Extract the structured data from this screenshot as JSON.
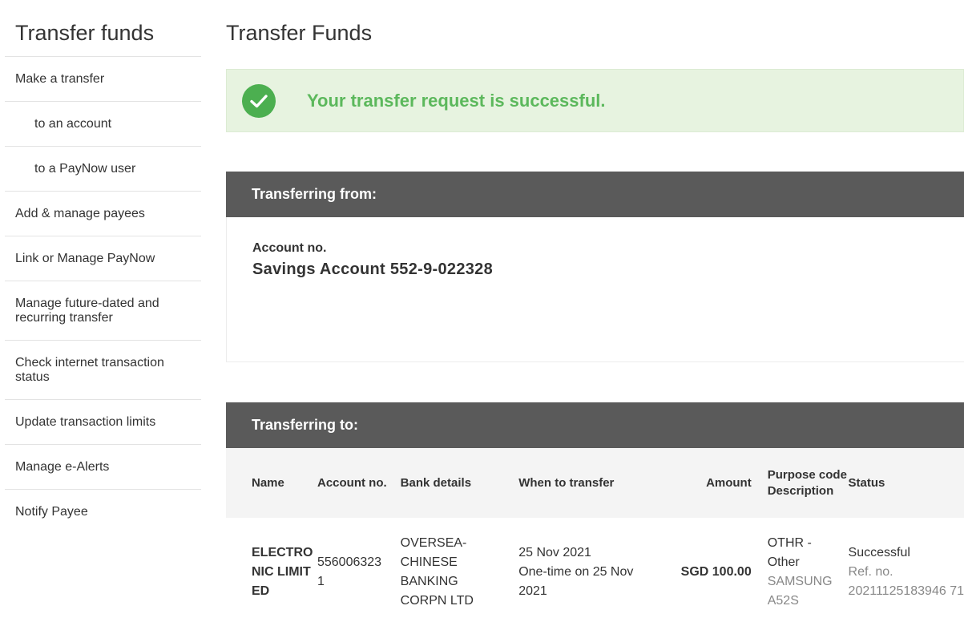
{
  "sidebar": {
    "title": "Transfer funds",
    "items": [
      {
        "label": "Make a transfer"
      },
      {
        "label": "to an account"
      },
      {
        "label": "to a PayNow user"
      },
      {
        "label": "Add & manage payees"
      },
      {
        "label": "Link or Manage PayNow"
      },
      {
        "label": "Manage future-dated and recurring transfer"
      },
      {
        "label": "Check internet transaction status"
      },
      {
        "label": "Update transaction limits"
      },
      {
        "label": "Manage e-Alerts"
      },
      {
        "label": "Notify Payee"
      }
    ]
  },
  "main": {
    "title": "Transfer Funds",
    "success_message": "Your transfer request is successful.",
    "from": {
      "header": "Transferring from:",
      "account_label": "Account no.",
      "account_value": "Savings Account 552-9-022328"
    },
    "to": {
      "header": "Transferring to:",
      "columns": {
        "name": "Name",
        "account": "Account no.",
        "bank": "Bank details",
        "when": "When to transfer",
        "amount": "Amount",
        "purpose": "Purpose code Description",
        "status": "Status"
      },
      "row": {
        "name": "ELECTRONIC LIMITED",
        "account": "5560063231",
        "bank": "OVERSEA-CHINESE BANKING CORPN LTD",
        "when_date": "25 Nov 2021",
        "when_desc": "One-time on 25 Nov 2021",
        "amount": "SGD 100.00",
        "purpose_code": "OTHR - Other",
        "purpose_desc": "SAMSUNG A52S",
        "status": "Successful",
        "ref_label": "Ref. no.",
        "ref_no": "20211125183946 71"
      }
    }
  },
  "colors": {
    "success_bg": "#e7f3e0",
    "success_text": "#5cb85c",
    "check_icon": "#4caf50",
    "panel_header": "#5a5a5a"
  },
  "icons": {
    "success": "check-circle-icon"
  }
}
